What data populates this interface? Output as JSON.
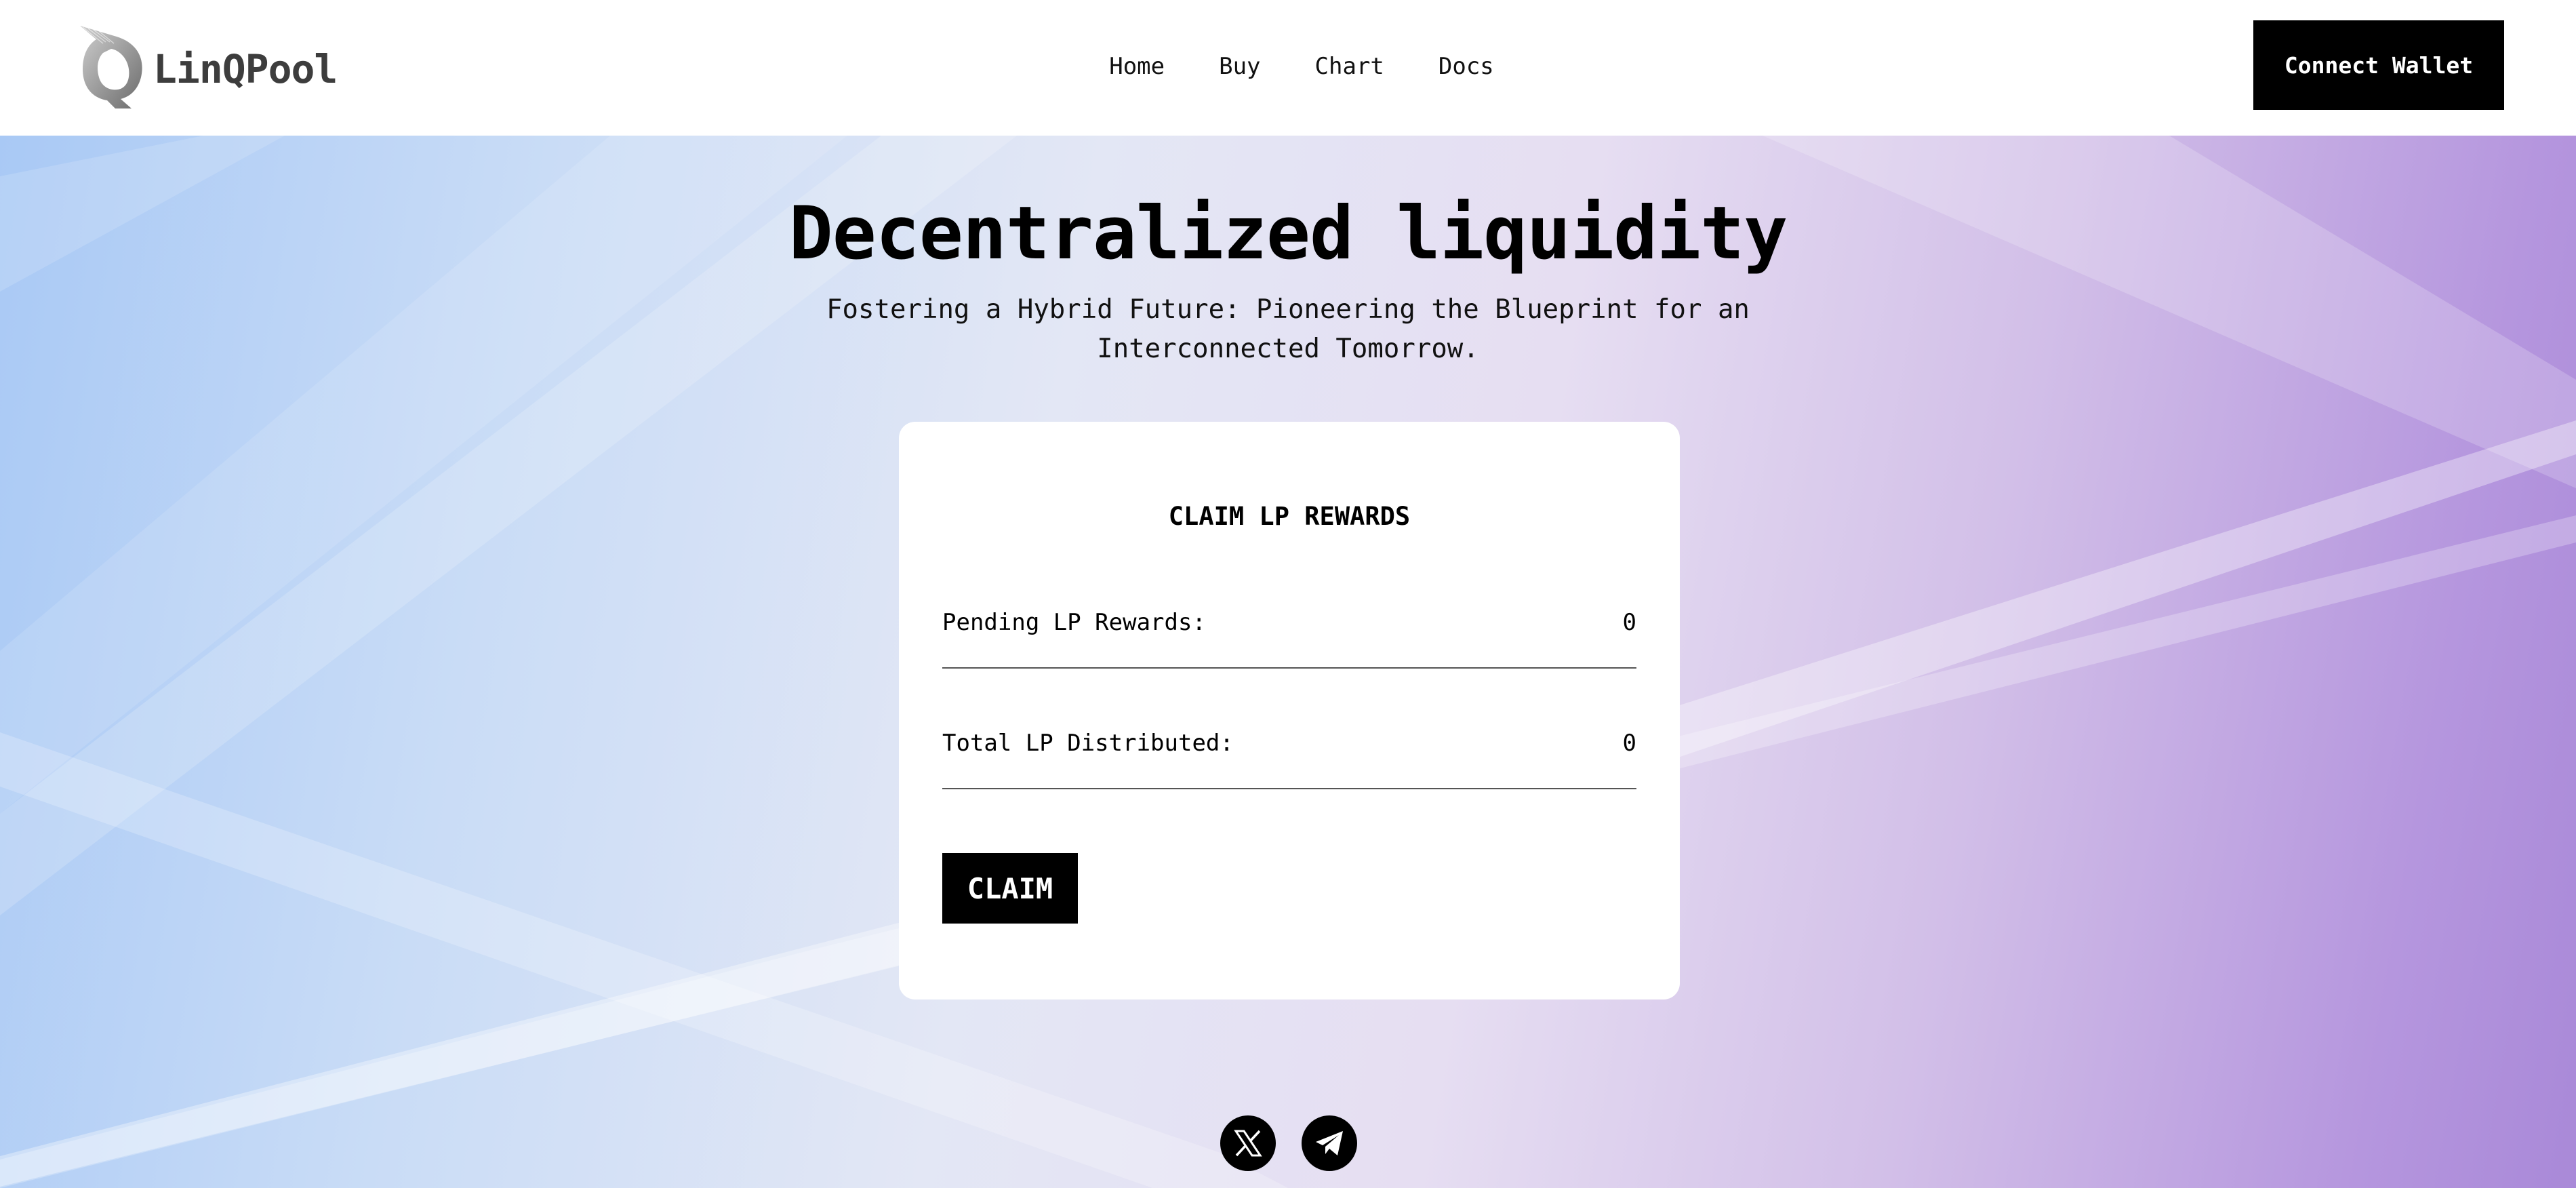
{
  "header": {
    "brand": "LinQPool",
    "nav": [
      {
        "label": "Home"
      },
      {
        "label": "Buy"
      },
      {
        "label": "Chart"
      },
      {
        "label": "Docs"
      }
    ],
    "connect_label": "Connect Wallet"
  },
  "hero": {
    "title": "Decentralized liquidity",
    "subtitle": "Fostering a Hybrid Future: Pioneering the Blueprint for an Interconnected Tomorrow."
  },
  "card": {
    "title": "CLAIM LP REWARDS",
    "rows": [
      {
        "label": "Pending LP Rewards:",
        "value": "0"
      },
      {
        "label": "Total LP Distributed:",
        "value": "0"
      }
    ],
    "claim_label": "CLAIM"
  },
  "socials": {
    "icons": [
      "x-icon",
      "telegram-icon"
    ]
  },
  "colors": {
    "primary": "#000000",
    "header_bg": "#ffffff",
    "gradient_start": "#a9c9f5",
    "gradient_end": "#a989d8"
  }
}
